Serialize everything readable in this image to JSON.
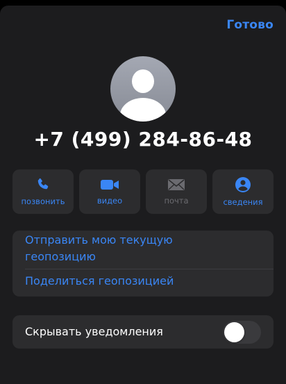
{
  "header": {
    "done_label": "Готово"
  },
  "contact": {
    "phone_number": "+7 (499) 284-86-48"
  },
  "actions": [
    {
      "label": "позвонить",
      "icon": "phone-icon",
      "enabled": true
    },
    {
      "label": "видео",
      "icon": "video-camera-icon",
      "enabled": true
    },
    {
      "label": "почта",
      "icon": "mail-icon",
      "enabled": false
    },
    {
      "label": "сведения",
      "icon": "person-circle-icon",
      "enabled": true
    }
  ],
  "location": {
    "send_current": "Отправить мою текущую геопозицию",
    "share": "Поделиться геопозицией"
  },
  "notifications": {
    "hide_label": "Скрывать уведомления",
    "hide_enabled": false
  },
  "colors": {
    "accent": "#3a86f5",
    "card_background": "#2c2c2e",
    "sheet_background": "#1c1c1e",
    "disabled": "#6b6b70"
  }
}
